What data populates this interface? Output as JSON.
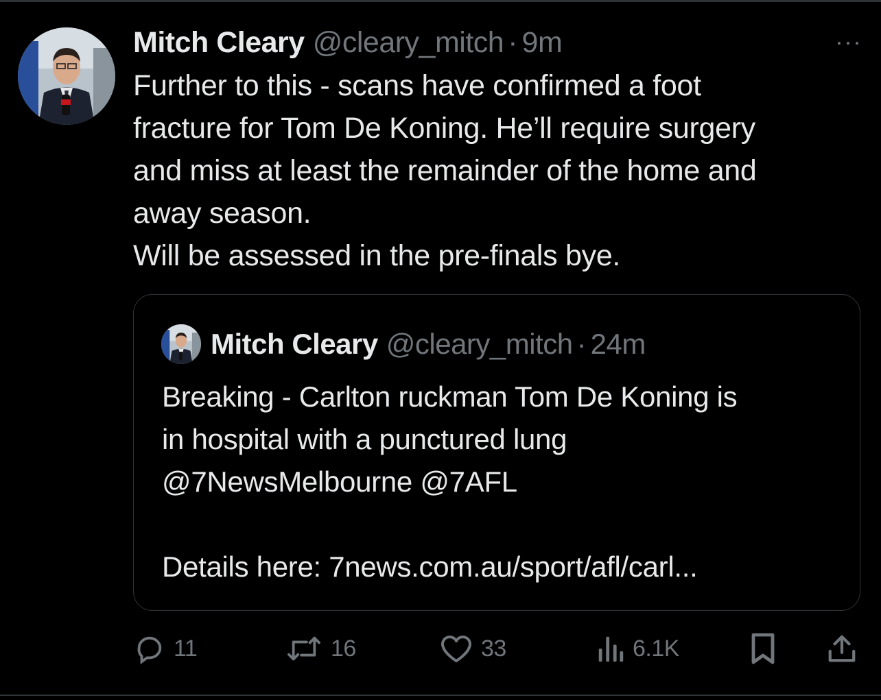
{
  "tweet": {
    "author_name": "Mitch Cleary",
    "handle": "@cleary_mitch",
    "separator": "·",
    "time": "9m",
    "more_label": "···",
    "lines": [
      "Further to this - scans have confirmed a foot",
      "fracture for Tom De Koning. He’ll require surgery",
      "and miss at least the remainder of the home and",
      "away season.",
      "Will be assessed in the pre-finals bye."
    ]
  },
  "quoted_tweet": {
    "author_name": "Mitch Cleary",
    "handle": "@cleary_mitch",
    "separator": "·",
    "time": "24m",
    "lines": [
      "Breaking - Carlton ruckman Tom De Koning is",
      "in hospital with a punctured lung",
      "@7NewsMelbourne @7AFL",
      "",
      "Details here: 7news.com.au/sport/afl/carl..."
    ]
  },
  "actions": {
    "replies": "11",
    "reposts": "16",
    "likes": "33",
    "views": "6.1K"
  },
  "icons": {
    "reply": "reply-icon",
    "repost": "repost-icon",
    "like": "like-icon",
    "views": "views-icon",
    "bookmark": "bookmark-icon",
    "share": "share-icon",
    "more": "more-icon"
  },
  "colors": {
    "background": "#000000",
    "primary_text": "#e7e9ea",
    "secondary_text": "#71767b",
    "border": "#2f3336"
  }
}
